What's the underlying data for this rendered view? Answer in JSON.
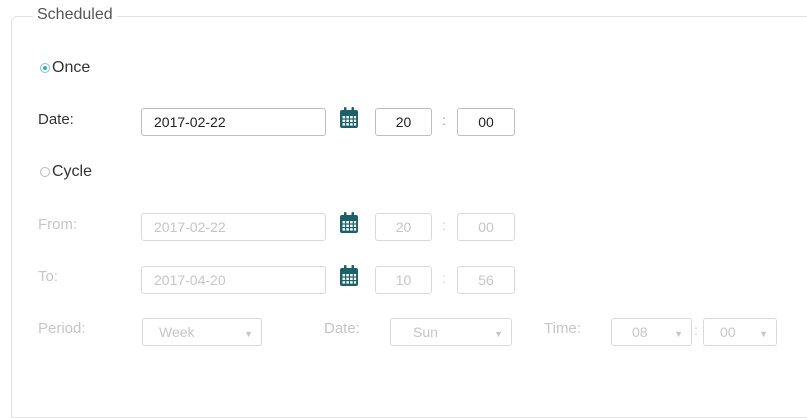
{
  "section": {
    "title": "Scheduled"
  },
  "once": {
    "label": "Once",
    "selected": true,
    "date_label": "Date:",
    "date_value": "2017-02-22",
    "hour": "20",
    "minute": "00",
    "separator": ":"
  },
  "cycle": {
    "label": "Cycle",
    "selected": false,
    "from_label": "From:",
    "from_date": "2017-02-22",
    "from_hour": "20",
    "from_minute": "00",
    "to_label": "To:",
    "to_date": "2017-04-20",
    "to_hour": "10",
    "to_minute": "56",
    "separator": ":",
    "period_label": "Period:",
    "period_value": "Week",
    "day_label": "Date:",
    "day_value": "Sun",
    "time_label": "Time:",
    "time_hour": "08",
    "time_minute": "00"
  },
  "icons": {
    "calendar": "calendar-icon",
    "dropdown": "chevron-down-icon"
  },
  "colors": {
    "accent": "#2fb3b6",
    "calendar": "#1d6168",
    "disabled": "#c6c6c6"
  }
}
